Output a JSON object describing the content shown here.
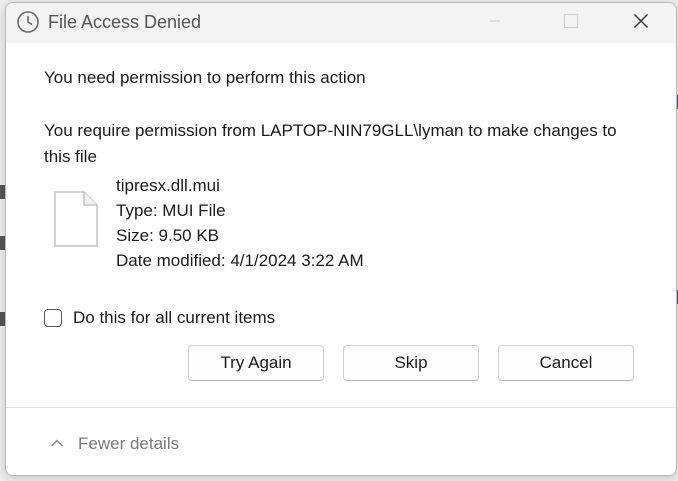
{
  "dialog": {
    "title": "File Access Denied",
    "heading": "You need permission to perform this action",
    "message": "You require permission from LAPTOP-NIN79GLL\\lyman to make changes to this file",
    "file": {
      "name": "tipresx.dll.mui",
      "type": "Type: MUI File",
      "size": "Size: 9.50 KB",
      "modified": "Date modified: 4/1/2024 3:22 AM"
    },
    "checkbox_label": "Do this for all current items",
    "checkbox_checked": false,
    "buttons": {
      "try_again": "Try Again",
      "skip": "Skip",
      "cancel": "Cancel"
    },
    "details_toggle": "Fewer details"
  },
  "icons": {
    "title": "clock-icon",
    "minimize": "minimize-icon",
    "maximize": "maximize-icon",
    "close": "close-icon",
    "file": "file-icon",
    "details": "chevron-up-icon"
  },
  "colors": {
    "titlebar": "#f3f3f3",
    "title_text": "#555555",
    "body_text": "#1a1a1a",
    "muted_text": "#7a7a7a"
  }
}
